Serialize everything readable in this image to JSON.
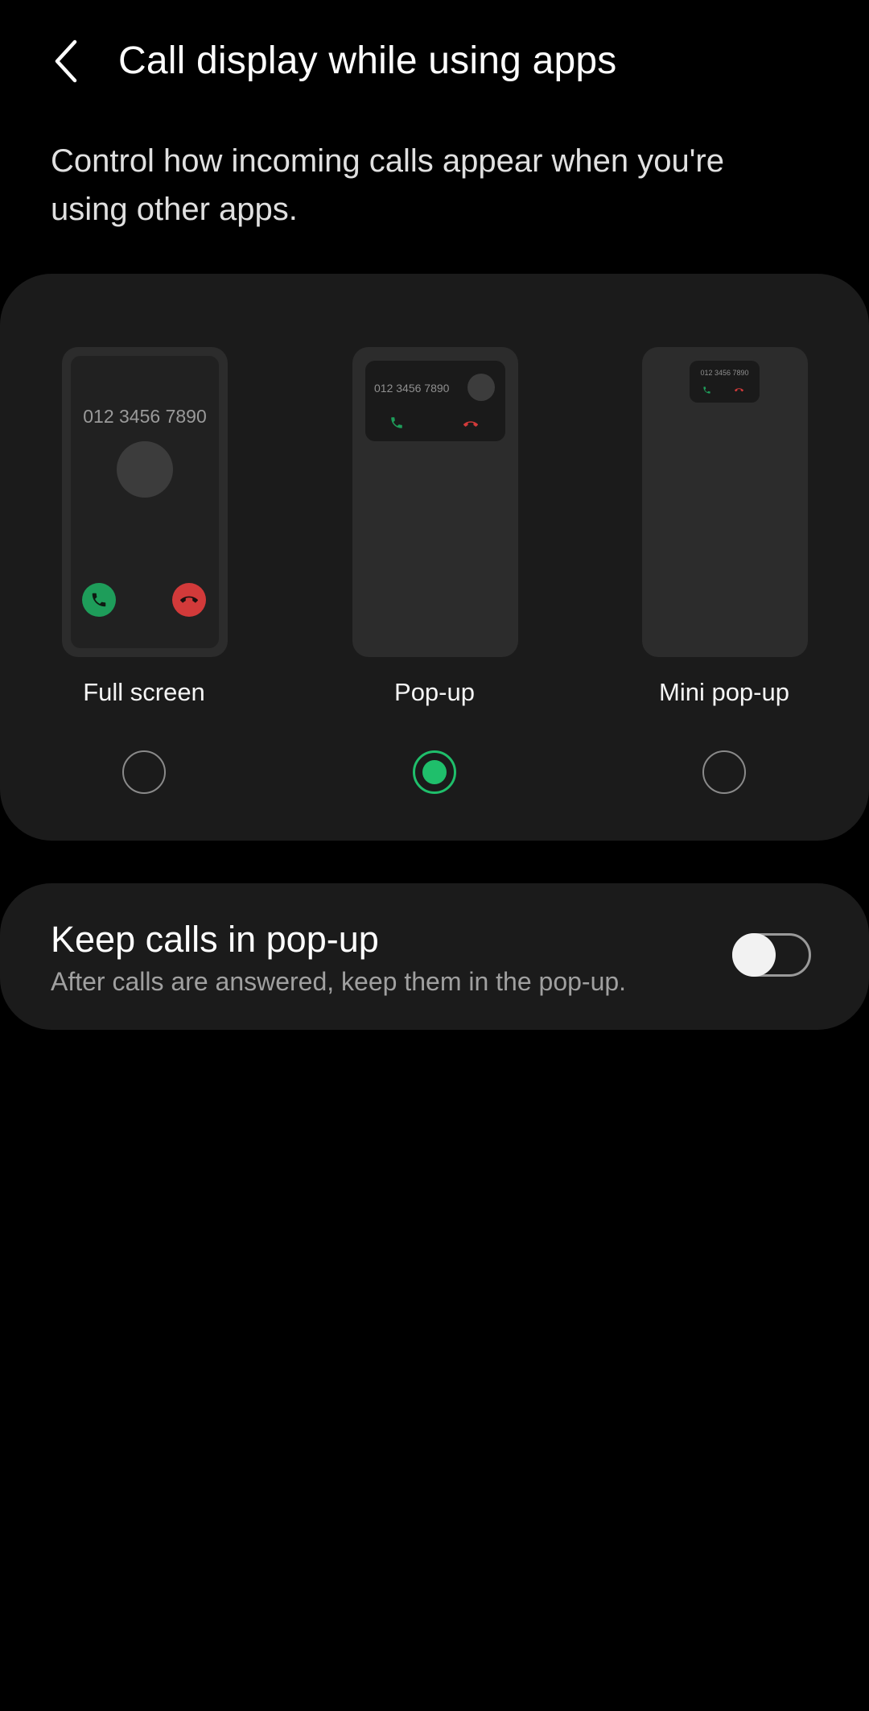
{
  "header": {
    "title": "Call display while using apps"
  },
  "description": "Control how incoming calls appear when you're using other apps.",
  "options": [
    {
      "label": "Full screen",
      "preview_number": "012 3456 7890",
      "selected": false
    },
    {
      "label": "Pop-up",
      "preview_number": "012 3456 7890",
      "selected": true
    },
    {
      "label": "Mini pop-up",
      "preview_number": "012 3456 7890",
      "selected": false
    }
  ],
  "keep_calls": {
    "title": "Keep calls in pop-up",
    "subtitle": "After calls are answered, keep them in the pop-up.",
    "enabled": false
  },
  "colors": {
    "accent_green": "#1fbf6b",
    "accept_green": "#1e9d5a",
    "decline_red": "#d23a3a",
    "card_background": "#1b1b1b"
  }
}
